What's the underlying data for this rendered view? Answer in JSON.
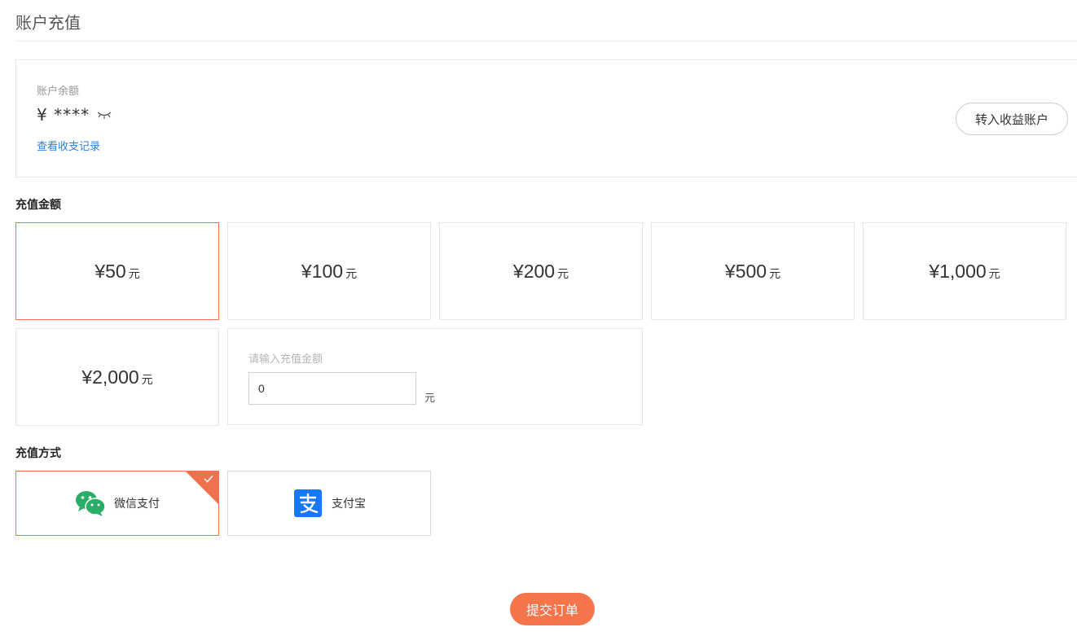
{
  "page": {
    "title": "账户充值"
  },
  "balance": {
    "label": "账户余额",
    "value": "¥ ****",
    "toggle_icon": "eye-closed-icon",
    "records_link": "查看收支记录",
    "transfer_button": "转入收益账户"
  },
  "amount_section": {
    "title": "充值金额",
    "options": [
      {
        "value": "¥50",
        "unit": "元",
        "selected": true
      },
      {
        "value": "¥100",
        "unit": "元",
        "selected": false
      },
      {
        "value": "¥200",
        "unit": "元",
        "selected": false
      },
      {
        "value": "¥500",
        "unit": "元",
        "selected": false
      },
      {
        "value": "¥1,000",
        "unit": "元",
        "selected": false
      },
      {
        "value": "¥2,000",
        "unit": "元",
        "selected": false
      }
    ],
    "custom": {
      "label": "请输入充值金额",
      "input_value": "0",
      "unit": "元"
    }
  },
  "method_section": {
    "title": "充值方式",
    "options": [
      {
        "label": "微信支付",
        "icon": "wechat-pay-icon",
        "selected": true
      },
      {
        "label": "支付宝",
        "icon": "alipay-icon",
        "selected": false
      }
    ]
  },
  "submit": {
    "label": "提交订单"
  },
  "colors": {
    "accent": "#f0714e",
    "submit_bg": "#f57449",
    "link": "#2d7fe0",
    "wechat_green": "#2aae67",
    "alipay_blue": "#1678ff"
  }
}
